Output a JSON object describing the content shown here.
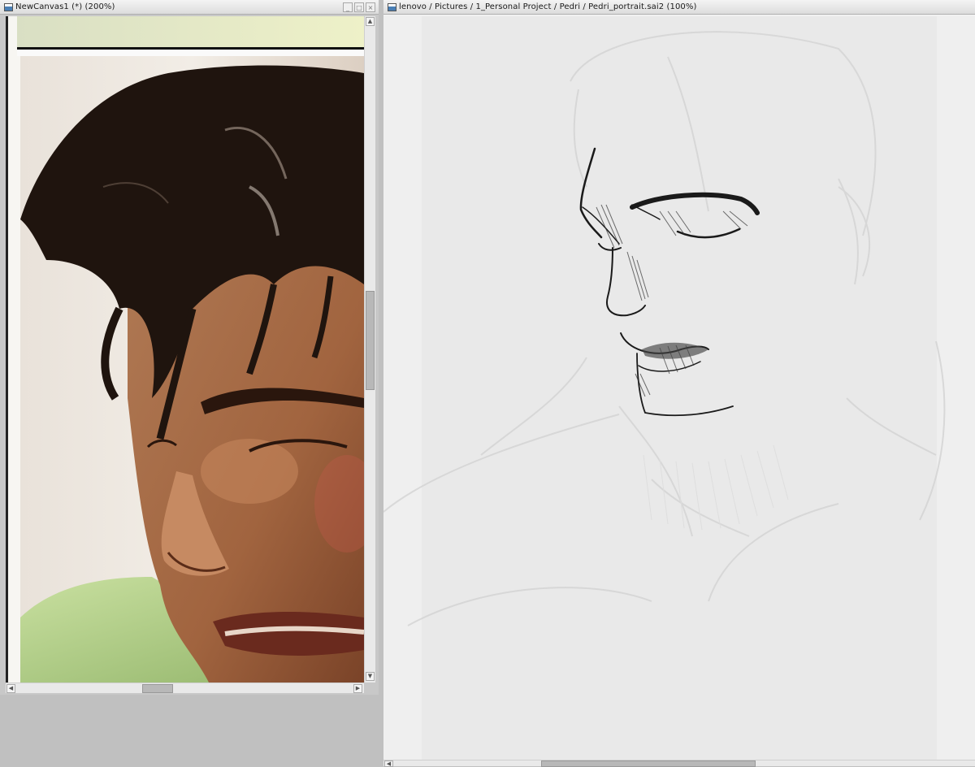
{
  "left_window": {
    "title": "NewCanvas1 (*) (200%)",
    "buttons": [
      "_",
      "□",
      "×"
    ],
    "image_description_icon": "reference-photo"
  },
  "right_window": {
    "title": "lenovo / Pictures / 1_Personal Project / Pedri / Pedri_portrait.sai2 (100%)"
  },
  "scroll_arrows": {
    "up": "▲",
    "down": "▼",
    "left": "◀",
    "right": "▶"
  },
  "colors": {
    "workspace": "#c0c0c0",
    "canvas_paper": "#e9e9e9",
    "titlebar": "#e6e6e6"
  }
}
